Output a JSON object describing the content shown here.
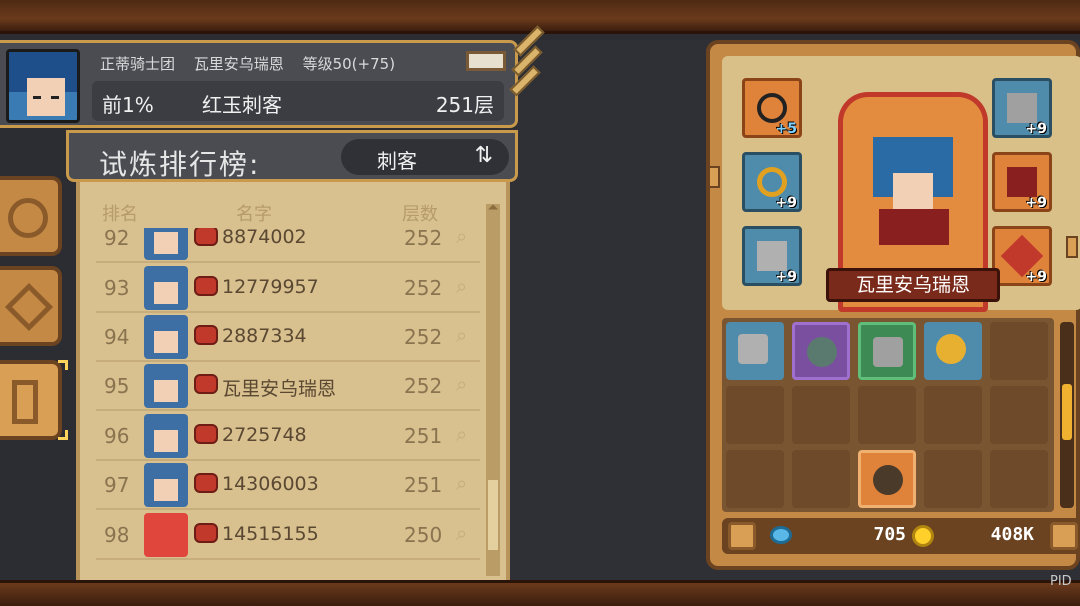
{
  "header": {
    "guild": "正蒂骑士团",
    "player_name": "瓦里安乌瑞恩",
    "level": "等级50(+75)",
    "rank_pct": "前1%",
    "title": "红玉刺客",
    "floor": "251层"
  },
  "leaderboard": {
    "title": "试炼排行榜:",
    "class_filter": "刺客",
    "switch_icon": "⇅",
    "columns": {
      "rank": "排名",
      "name": "名字",
      "floors": "层数"
    },
    "rows": [
      {
        "rank": "92",
        "name": "8874002",
        "floors": "252"
      },
      {
        "rank": "93",
        "name": "12779957",
        "floors": "252"
      },
      {
        "rank": "94",
        "name": "2887334",
        "floors": "252"
      },
      {
        "rank": "95",
        "name": "瓦里安乌瑞恩",
        "floors": "252"
      },
      {
        "rank": "96",
        "name": "2725748",
        "floors": "251"
      },
      {
        "rank": "97",
        "name": "14306003",
        "floors": "251"
      },
      {
        "rank": "98",
        "name": "14515155",
        "floors": "250"
      }
    ]
  },
  "equipment": {
    "hero_name": "瓦里安乌瑞恩",
    "left_slots": [
      "+5",
      "+9",
      "+9"
    ],
    "right_slots": [
      "+9",
      "+9",
      "+9"
    ]
  },
  "inventory": {
    "gems": "705",
    "gold": "408K"
  },
  "watermark": "PID"
}
